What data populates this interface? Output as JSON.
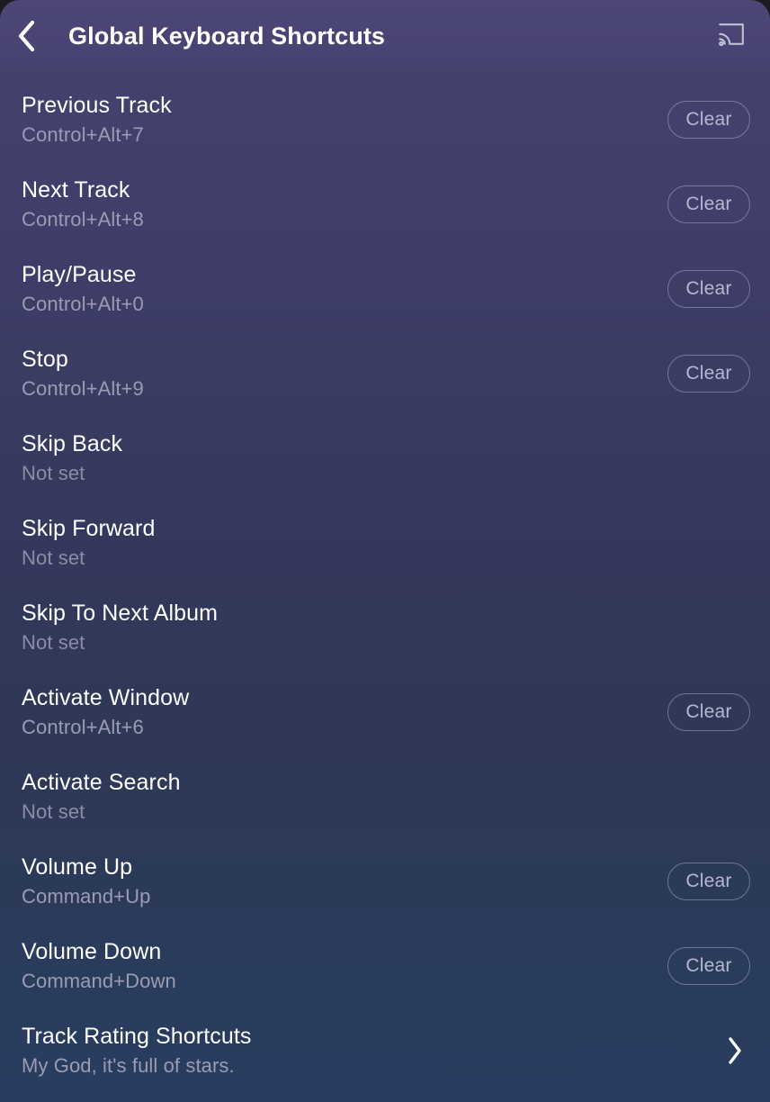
{
  "header": {
    "back_icon": "back-chevron-icon",
    "title": "Global Keyboard Shortcuts",
    "cast_icon": "cast-icon"
  },
  "colors": {
    "gradient_top": "#474272",
    "gradient_bottom": "#293d60",
    "title_text": "#ffffff",
    "subtitle_text": "#9b9cb4",
    "clear_button_text": "#b6b7d2",
    "clear_button_border": "#bebee1"
  },
  "labels": {
    "clear": "Clear",
    "not_set": "Not set"
  },
  "shortcuts": [
    {
      "title": "Previous Track",
      "value": "Control+Alt+7",
      "action": "clear",
      "action_label": "Clear"
    },
    {
      "title": "Next Track",
      "value": "Control+Alt+8",
      "action": "clear",
      "action_label": "Clear"
    },
    {
      "title": "Play/Pause",
      "value": "Control+Alt+0",
      "action": "clear",
      "action_label": "Clear"
    },
    {
      "title": "Stop",
      "value": "Control+Alt+9",
      "action": "clear",
      "action_label": "Clear"
    },
    {
      "title": "Skip Back",
      "value": "Not set",
      "action": "none",
      "action_label": ""
    },
    {
      "title": "Skip Forward",
      "value": "Not set",
      "action": "none",
      "action_label": ""
    },
    {
      "title": "Skip To Next Album",
      "value": "Not set",
      "action": "none",
      "action_label": ""
    },
    {
      "title": "Activate Window",
      "value": "Control+Alt+6",
      "action": "clear",
      "action_label": "Clear"
    },
    {
      "title": "Activate Search",
      "value": "Not set",
      "action": "none",
      "action_label": ""
    },
    {
      "title": "Volume Up",
      "value": "Command+Up",
      "action": "clear",
      "action_label": "Clear"
    },
    {
      "title": "Volume Down",
      "value": "Command+Down",
      "action": "clear",
      "action_label": "Clear"
    },
    {
      "title": "Track Rating Shortcuts",
      "value": "My God, it's full of stars.",
      "action": "chevron",
      "action_label": ""
    }
  ]
}
